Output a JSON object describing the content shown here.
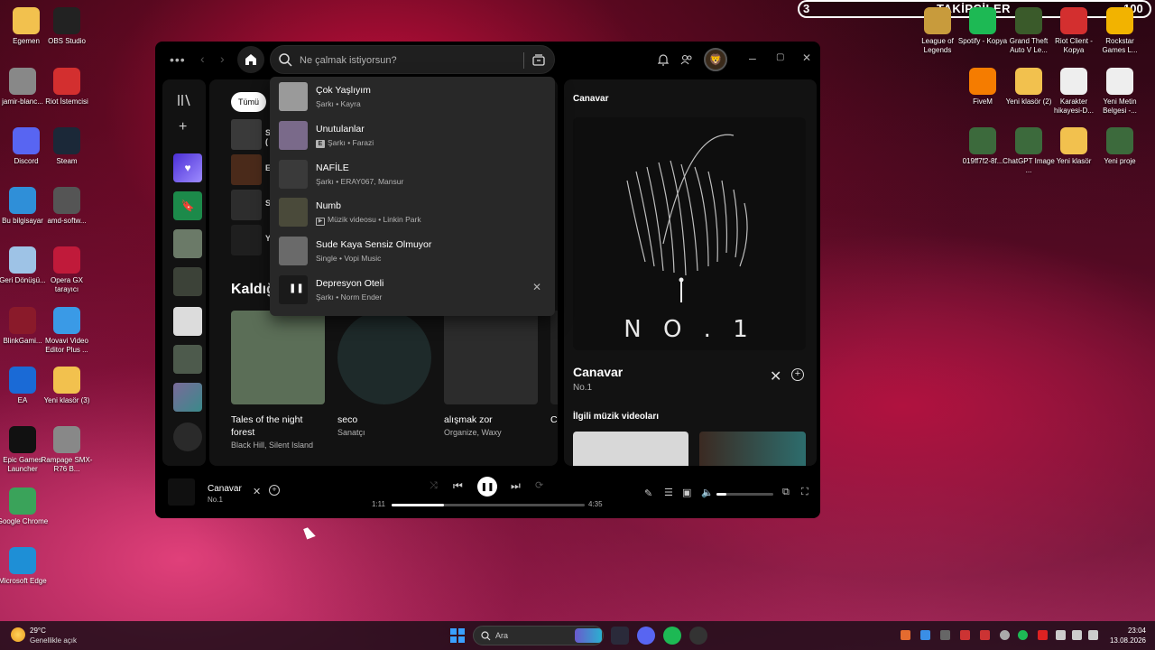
{
  "overlay": {
    "left_count": "3",
    "title": "TAKİPÇİLER",
    "right_count": "100"
  },
  "desktop_left": [
    {
      "label": "Egemen",
      "icon": "folder-icon"
    },
    {
      "label": "OBS Studio",
      "icon": "obs-icon"
    },
    {
      "label": "jamir-blanc...",
      "icon": "file-icon"
    },
    {
      "label": "Riot İstemcisi",
      "icon": "riot-icon"
    },
    {
      "label": "Discord",
      "icon": "discord-icon"
    },
    {
      "label": "Steam",
      "icon": "steam-icon"
    },
    {
      "label": "Bu bilgisayar",
      "icon": "computer-icon"
    },
    {
      "label": "amd-softw...",
      "icon": "shield-icon"
    },
    {
      "label": "Geri Dönüşü...",
      "icon": "recycle-bin-icon"
    },
    {
      "label": "Opera GX tarayıcı",
      "icon": "opera-icon"
    },
    {
      "label": "BlinkGami...",
      "icon": "app-icon"
    },
    {
      "label": "Movavi Video Editor Plus ...",
      "icon": "video-editor-icon"
    },
    {
      "label": "EA",
      "icon": "ea-icon"
    },
    {
      "label": "Yeni klasör (3)",
      "icon": "folder-icon"
    },
    {
      "label": "Epic Games Launcher",
      "icon": "epic-icon"
    },
    {
      "label": "Rampage SMX-R76 B...",
      "icon": "file-icon"
    },
    {
      "label": "Google Chrome",
      "icon": "chrome-icon"
    },
    {
      "label": "Microsoft Edge",
      "icon": "edge-icon"
    }
  ],
  "desktop_right": [
    {
      "label": "League of Legends",
      "icon": "lol-icon"
    },
    {
      "label": "Spotify - Kopya",
      "icon": "spotify-icon"
    },
    {
      "label": "Grand Theft Auto V Le...",
      "icon": "gta-icon"
    },
    {
      "label": "Riot Client - Kopya",
      "icon": "riot-icon"
    },
    {
      "label": "Rockstar Games L...",
      "icon": "rockstar-icon"
    },
    {
      "label": "FiveM",
      "icon": "fivem-icon"
    },
    {
      "label": "Yeni klasör (2)",
      "icon": "folder-icon"
    },
    {
      "label": "Karakter hikayesi-D...",
      "icon": "document-icon"
    },
    {
      "label": "Yeni Metin Belgesi -...",
      "icon": "document-icon"
    },
    {
      "label": "019ff7f2-8f...",
      "icon": "image-icon"
    },
    {
      "label": "ChatGPT Image ...",
      "icon": "image-icon"
    },
    {
      "label": "Yeni klasör",
      "icon": "folder-icon"
    },
    {
      "label": "Yeni proje",
      "icon": "image-icon"
    }
  ],
  "search": {
    "placeholder": "Ne çalmak istiyorsun?"
  },
  "main": {
    "filter_chip": "Tümü",
    "recent": [
      {
        "letter": "S (",
        "color": "#3a3a3a"
      },
      {
        "letter": "E",
        "color": "#4a2a1a"
      },
      {
        "letter": "S",
        "color": "#2d2d2d"
      },
      {
        "letter": "Y",
        "color": "#1f1f1f"
      }
    ],
    "section_title": "Kaldığ",
    "cards": [
      {
        "title": "Tales of the night forest",
        "subtitle": "Black Hill, Silent Island",
        "color": "#5b6e57",
        "round": false
      },
      {
        "title": "seco",
        "subtitle": "Sanatçı",
        "color": "#1e2a2a",
        "round": true
      },
      {
        "title": "alışmak zor",
        "subtitle": "Organize, Waxy",
        "color": "#2c2c2c",
        "round": false
      },
      {
        "title": "C",
        "subtitle": "",
        "color": "#222222",
        "round": false
      }
    ]
  },
  "dropdown": [
    {
      "title": "Çok Yaşlıyım",
      "subtitle": "Şarkı • Kayra",
      "badge": "",
      "color": "#9a9a9a"
    },
    {
      "title": "Unutulanlar",
      "subtitle": "Şarkı • Farazi",
      "badge": "E",
      "color": "#7a6a8a"
    },
    {
      "title": "NAFİLE",
      "subtitle": "Şarkı • ERAY067, Mansur",
      "badge": "",
      "color": "#3a3a3a"
    },
    {
      "title": "Numb",
      "subtitle": "Müzik videosu • Linkin Park",
      "badge": "video",
      "color": "#4a4a3a"
    },
    {
      "title": "Sude Kaya Sensiz Olmuyor",
      "subtitle": "Single • Vopi Music",
      "badge": "",
      "color": "#6a6a6a"
    },
    {
      "title": "Depresyon Oteli",
      "subtitle": "Şarkı • Norm Ender",
      "badge": "",
      "color": "#1a1a1a"
    }
  ],
  "now_playing": {
    "panel_label": "Canavar",
    "art_text": "N O . 1",
    "title": "Canavar",
    "subtitle": "No.1",
    "videos_label": "İlgili müzik videoları"
  },
  "player": {
    "title": "Canavar",
    "subtitle": "No.1",
    "elapsed": "1:11",
    "duration": "4:35",
    "progress": 0.27,
    "volume": 0.18
  },
  "taskbar": {
    "temp": "29°C",
    "weather": "Genellikle açık",
    "search_placeholder": "Ara",
    "time": "23:04",
    "date": "13.08.2026"
  }
}
